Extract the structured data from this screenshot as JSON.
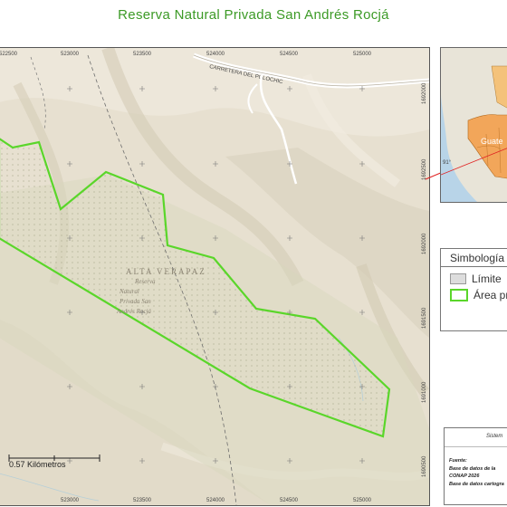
{
  "title": "Reserva Natural Privada San Andrés Rocjá",
  "map": {
    "easting_labels": [
      "522500",
      "523000",
      "523500",
      "524000",
      "524500",
      "525000"
    ],
    "northing_labels": [
      "1692000",
      "1692500",
      "1692000",
      "1691500",
      "1691000",
      "1690500"
    ],
    "road_label": "CARRETERA DEL POLOCHIC",
    "region_label": "ALTA VERAPAZ",
    "reserve_label_lines": [
      "Reserva",
      "Natural",
      "Privada San",
      "Andrés Rocjá"
    ]
  },
  "inset": {
    "country_label": "Guate",
    "lon_label": "91°"
  },
  "legend": {
    "title": "Simbología",
    "items": [
      {
        "label": "Límite",
        "color": "#dddddd",
        "border": "#999999"
      },
      {
        "label": "Área pr",
        "color": "#ffffff",
        "border": "#5ad62a"
      }
    ]
  },
  "info": {
    "heading": "Sistem",
    "source_label": "Fuente:",
    "lines": [
      "Base de datos de la",
      "CONAP 2026",
      "Base de datos cartogra"
    ]
  },
  "scale": {
    "label": "0.57 Kilómetros"
  },
  "colors": {
    "title": "#3c9a26",
    "boundary": "#5ad62a",
    "guatemala_fill": "#f2a65a",
    "water": "#b8d4e8",
    "locator_line": "#e02020"
  }
}
